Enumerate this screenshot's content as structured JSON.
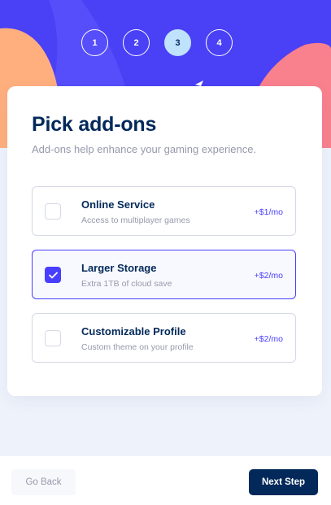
{
  "steps": [
    {
      "number": "1",
      "active": false
    },
    {
      "number": "2",
      "active": false
    },
    {
      "number": "3",
      "active": true
    },
    {
      "number": "4",
      "active": false
    }
  ],
  "header": {
    "title": "Pick add-ons",
    "subtitle": "Add-ons help enhance your gaming experience."
  },
  "addons": [
    {
      "name": "Online Service",
      "description": "Access to multiplayer games",
      "price": "+$1/mo",
      "checked": false
    },
    {
      "name": "Larger Storage",
      "description": "Extra 1TB of cloud save",
      "price": "+$2/mo",
      "checked": true
    },
    {
      "name": "Customizable Profile",
      "description": "Custom theme on your profile",
      "price": "+$2/mo",
      "checked": false
    }
  ],
  "footer": {
    "back_label": "Go Back",
    "next_label": "Next Step"
  },
  "colors": {
    "primary": "#02295a",
    "accent": "#483eff",
    "hero_purple": "#4a40f5",
    "hero_orange": "#ffaf7e",
    "hero_pink": "#f9818e",
    "active_step": "#bfe2fd",
    "muted": "#9699ab"
  },
  "icons": [
    "checkmark-icon"
  ]
}
